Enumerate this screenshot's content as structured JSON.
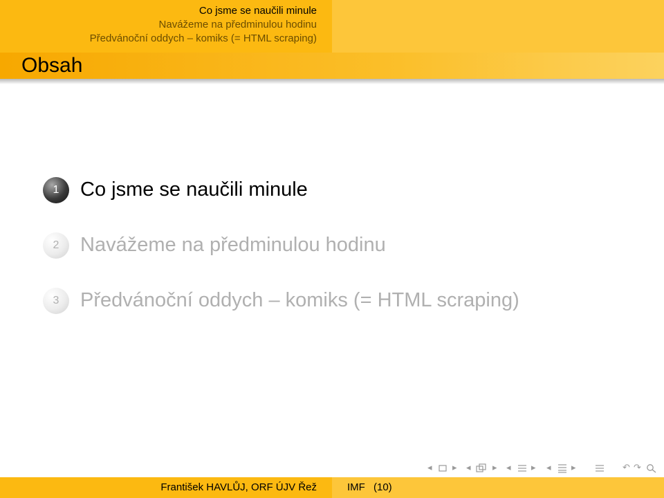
{
  "header": {
    "sections": [
      "Co jsme se naučili minule",
      "Navážeme na předminulou hodinu",
      "Předvánoční oddych – komiks (= HTML scraping)"
    ]
  },
  "frame_title": "Obsah",
  "toc": [
    {
      "number": "1",
      "text": "Co jsme se naučili minule"
    },
    {
      "number": "2",
      "text": "Navážeme na předminulou hodinu"
    },
    {
      "number": "3",
      "text": "Předvánoční oddych – komiks (= HTML scraping)"
    }
  ],
  "footer": {
    "author": "František HAVLŮJ, ORF ÚJV Řež",
    "title": "IMF",
    "page": "(10)"
  },
  "colors": {
    "header_left": "#fcb911",
    "header_right": "#fdc63a",
    "active_text": "#000000",
    "dimmed_text": "#b0b0b0"
  },
  "icons": [
    "arrow-left-icon",
    "frame-icon",
    "arrow-right-icon",
    "arrow-left-icon",
    "subsection-icon",
    "arrow-right-icon",
    "arrow-left-icon",
    "section-icon",
    "arrow-right-icon",
    "arrow-left-icon",
    "document-icon",
    "arrow-right-icon",
    "align-icon",
    "back-icon",
    "forward-icon",
    "search-icon"
  ]
}
